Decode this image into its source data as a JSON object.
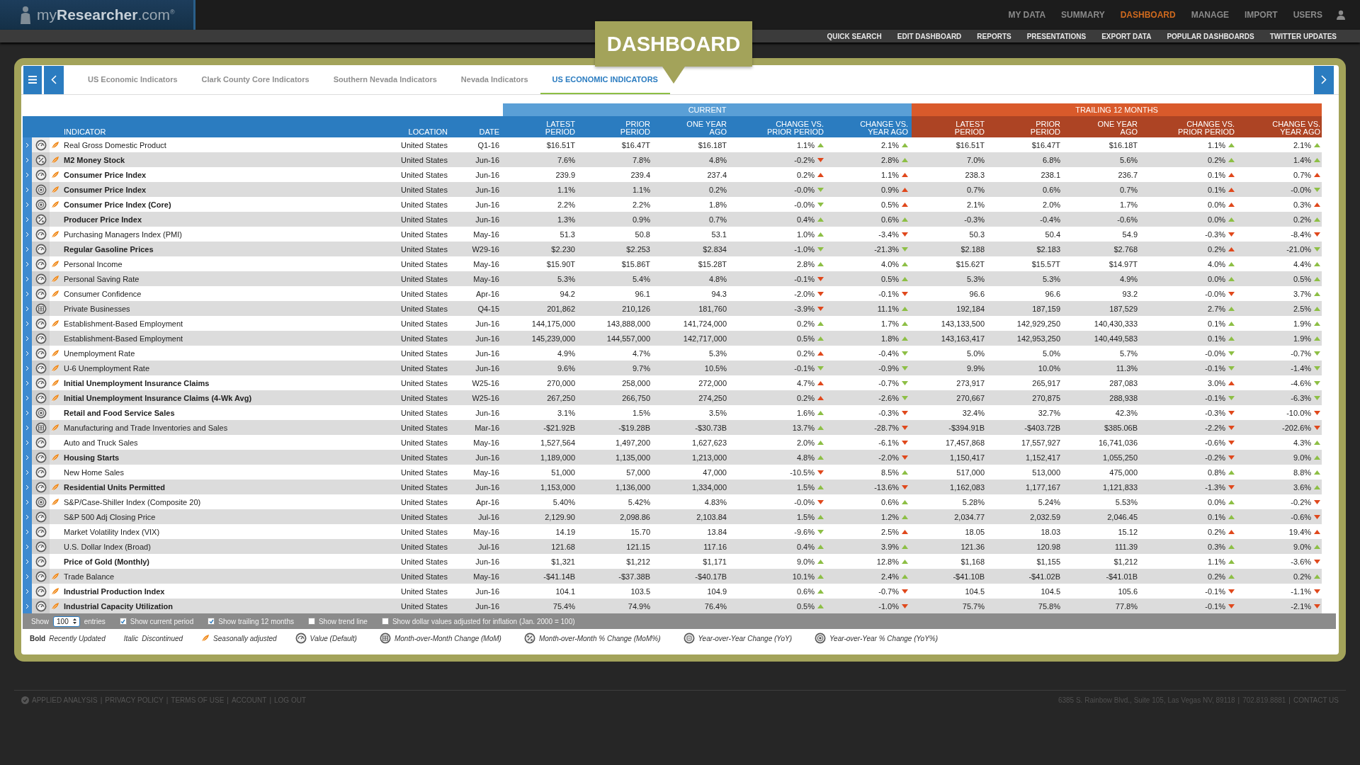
{
  "logo": {
    "text": "my**Researcher**.com$^{®}$"
  },
  "nav": [
    {
      "label": "MY DATA",
      "selected": false
    },
    {
      "label": "SUMMARY",
      "selected": false
    },
    {
      "label": "DASHBOARD",
      "selected": true
    },
    {
      "label": "MANAGE",
      "selected": false
    },
    {
      "label": "IMPORT",
      "selected": false
    },
    {
      "label": "USERS",
      "selected": false
    }
  ],
  "subnav": [
    "QUICK SEARCH",
    "EDIT DASHBOARD",
    "REPORTS",
    "PRESENTATIONS",
    "EXPORT DATA",
    "POPULAR DASHBOARDS",
    "TWITTER UPDATES"
  ],
  "page_title": "DASHBOARD",
  "tabs": [
    {
      "label": "US Economic Indicators",
      "selected": false
    },
    {
      "label": "Clark County Core Indicators",
      "selected": false
    },
    {
      "label": "Southern Nevada Indicators",
      "selected": false
    },
    {
      "label": "Nevada Indicators",
      "selected": false
    },
    {
      "label": "US ECONOMIC INDICATORS",
      "selected": true
    }
  ],
  "table": {
    "groups": [
      "CURRENT",
      "TRAILING 12 MONTHS"
    ],
    "columns": [
      "INDICATOR",
      "LOCATION",
      "DATE"
    ],
    "current_columns": [
      "LATEST PERIOD",
      "PRIOR PERIOD",
      "ONE YEAR AGO",
      "CHANGE VS. PRIOR PERIOD",
      "CHANGE VS. YEAR AGO"
    ],
    "trailing_columns": [
      "LATEST PERIOD",
      "PRIOR PERIOD",
      "ONE YEAR AGO",
      "CHANGE VS. PRIOR PERIOD",
      "CHANGE VS. YEAR AGO"
    ],
    "rows": [
      {
        "indicator": "Real Gross Domestic Product",
        "kind": "value",
        "seasonal": true,
        "bold": false,
        "location": "United States",
        "date": "Q1-16",
        "current": [
          "$16.51T",
          "$16.47T",
          "$16.18T"
        ],
        "current_chg": [
          {
            "v": "1.1%",
            "kind": "up",
            "good": true
          },
          {
            "v": "2.1%",
            "kind": "up",
            "good": true
          }
        ],
        "trailing": [
          "$16.51T",
          "$16.47T",
          "$16.18T"
        ],
        "trailing_chg": [
          {
            "v": "1.1%",
            "kind": "up",
            "good": true
          },
          {
            "v": "2.1%",
            "kind": "up",
            "good": true
          }
        ]
      },
      {
        "indicator": "M2 Money Stock",
        "kind": "mompct",
        "seasonal": true,
        "bold": true,
        "location": "United States",
        "date": "Jun-16",
        "current": [
          "7.6%",
          "7.8%",
          "4.8%"
        ],
        "current_chg": [
          {
            "v": "-0.2%",
            "kind": "down",
            "good": false
          },
          {
            "v": "2.8%",
            "kind": "up",
            "good": true
          }
        ],
        "trailing": [
          "7.0%",
          "6.8%",
          "5.6%"
        ],
        "trailing_chg": [
          {
            "v": "0.2%",
            "kind": "up",
            "good": true
          },
          {
            "v": "1.4%",
            "kind": "up",
            "good": true
          }
        ]
      },
      {
        "indicator": "Consumer Price Index",
        "kind": "value",
        "seasonal": true,
        "bold": true,
        "location": "United States",
        "date": "Jun-16",
        "current": [
          "239.9",
          "239.4",
          "237.4"
        ],
        "current_chg": [
          {
            "v": "0.2%",
            "kind": "up",
            "good": false
          },
          {
            "v": "1.1%",
            "kind": "up",
            "good": false
          }
        ],
        "trailing": [
          "238.3",
          "238.1",
          "236.7"
        ],
        "trailing_chg": [
          {
            "v": "0.1%",
            "kind": "up",
            "good": false
          },
          {
            "v": "0.7%",
            "kind": "up",
            "good": false
          }
        ]
      },
      {
        "indicator": "Consumer Price Index",
        "kind": "yoypct",
        "seasonal": true,
        "bold": true,
        "location": "United States",
        "date": "Jun-16",
        "current": [
          "1.1%",
          "1.1%",
          "0.2%"
        ],
        "current_chg": [
          {
            "v": "-0.0%",
            "kind": "down",
            "good": true
          },
          {
            "v": "0.9%",
            "kind": "up",
            "good": false
          }
        ],
        "trailing": [
          "0.7%",
          "0.6%",
          "0.7%"
        ],
        "trailing_chg": [
          {
            "v": "0.1%",
            "kind": "up",
            "good": false
          },
          {
            "v": "-0.0%",
            "kind": "down",
            "good": true
          }
        ]
      },
      {
        "indicator": "Consumer Price Index (Core)",
        "kind": "yoypct",
        "seasonal": true,
        "bold": true,
        "location": "United States",
        "date": "Jun-16",
        "current": [
          "2.2%",
          "2.2%",
          "1.8%"
        ],
        "current_chg": [
          {
            "v": "-0.0%",
            "kind": "down",
            "good": true
          },
          {
            "v": "0.5%",
            "kind": "up",
            "good": false
          }
        ],
        "trailing": [
          "2.1%",
          "2.0%",
          "1.7%"
        ],
        "trailing_chg": [
          {
            "v": "0.0%",
            "kind": "up",
            "good": false
          },
          {
            "v": "0.3%",
            "kind": "up",
            "good": false
          }
        ]
      },
      {
        "indicator": "Producer Price Index",
        "kind": "mompct",
        "seasonal": false,
        "bold": true,
        "location": "United States",
        "date": "Jun-16",
        "current": [
          "1.3%",
          "0.9%",
          "0.7%"
        ],
        "current_chg": [
          {
            "v": "0.4%",
            "kind": "up",
            "good": true
          },
          {
            "v": "0.6%",
            "kind": "up",
            "good": true
          }
        ],
        "trailing": [
          "-0.3%",
          "-0.4%",
          "-0.6%"
        ],
        "trailing_chg": [
          {
            "v": "0.0%",
            "kind": "up",
            "good": true
          },
          {
            "v": "0.2%",
            "kind": "up",
            "good": true
          }
        ]
      },
      {
        "indicator": "Purchasing Managers Index (PMI)",
        "kind": "value",
        "seasonal": true,
        "bold": false,
        "location": "United States",
        "date": "May-16",
        "current": [
          "51.3",
          "50.8",
          "53.1"
        ],
        "current_chg": [
          {
            "v": "1.0%",
            "kind": "up",
            "good": true
          },
          {
            "v": "-3.4%",
            "kind": "down",
            "good": false
          }
        ],
        "trailing": [
          "50.3",
          "50.4",
          "54.9"
        ],
        "trailing_chg": [
          {
            "v": "-0.3%",
            "kind": "down",
            "good": false
          },
          {
            "v": "-8.4%",
            "kind": "down",
            "good": false
          }
        ]
      },
      {
        "indicator": "Regular Gasoline Prices",
        "kind": "value",
        "seasonal": false,
        "bold": true,
        "location": "United States",
        "date": "W29-16",
        "current": [
          "$2.230",
          "$2.253",
          "$2.834"
        ],
        "current_chg": [
          {
            "v": "-1.0%",
            "kind": "down",
            "good": true
          },
          {
            "v": "-21.3%",
            "kind": "down",
            "good": true
          }
        ],
        "trailing": [
          "$2.188",
          "$2.183",
          "$2.768"
        ],
        "trailing_chg": [
          {
            "v": "0.2%",
            "kind": "up",
            "good": false
          },
          {
            "v": "-21.0%",
            "kind": "down",
            "good": true
          }
        ]
      },
      {
        "indicator": "Personal Income",
        "kind": "value",
        "seasonal": true,
        "bold": false,
        "location": "United States",
        "date": "May-16",
        "current": [
          "$15.90T",
          "$15.86T",
          "$15.28T"
        ],
        "current_chg": [
          {
            "v": "2.8%",
            "kind": "up",
            "good": true
          },
          {
            "v": "4.0%",
            "kind": "up",
            "good": true
          }
        ],
        "trailing": [
          "$15.62T",
          "$15.57T",
          "$14.97T"
        ],
        "trailing_chg": [
          {
            "v": "4.0%",
            "kind": "up",
            "good": true
          },
          {
            "v": "4.4%",
            "kind": "up",
            "good": true
          }
        ]
      },
      {
        "indicator": "Personal Saving Rate",
        "kind": "value",
        "seasonal": true,
        "bold": false,
        "location": "United States",
        "date": "May-16",
        "current": [
          "5.3%",
          "5.4%",
          "4.8%"
        ],
        "current_chg": [
          {
            "v": "-0.1%",
            "kind": "down",
            "good": false
          },
          {
            "v": "0.5%",
            "kind": "up",
            "good": true
          }
        ],
        "trailing": [
          "5.3%",
          "5.3%",
          "4.9%"
        ],
        "trailing_chg": [
          {
            "v": "0.0%",
            "kind": "up",
            "good": true
          },
          {
            "v": "0.5%",
            "kind": "up",
            "good": true
          }
        ]
      },
      {
        "indicator": "Consumer Confidence",
        "kind": "value",
        "seasonal": true,
        "bold": false,
        "location": "United States",
        "date": "Apr-16",
        "current": [
          "94.2",
          "96.1",
          "94.3"
        ],
        "current_chg": [
          {
            "v": "-2.0%",
            "kind": "down",
            "good": false
          },
          {
            "v": "-0.1%",
            "kind": "down",
            "good": false
          }
        ],
        "trailing": [
          "96.6",
          "96.6",
          "93.2"
        ],
        "trailing_chg": [
          {
            "v": "-0.0%",
            "kind": "down",
            "good": false
          },
          {
            "v": "3.7%",
            "kind": "up",
            "good": true
          }
        ]
      },
      {
        "indicator": "Private Businesses",
        "kind": "mom",
        "seasonal": false,
        "bold": false,
        "location": "United States",
        "date": "Q4-15",
        "current": [
          "201,862",
          "210,126",
          "181,760"
        ],
        "current_chg": [
          {
            "v": "-3.9%",
            "kind": "down",
            "good": false
          },
          {
            "v": "11.1%",
            "kind": "up",
            "good": true
          }
        ],
        "trailing": [
          "192,184",
          "187,159",
          "187,529"
        ],
        "trailing_chg": [
          {
            "v": "2.7%",
            "kind": "up",
            "good": true
          },
          {
            "v": "2.5%",
            "kind": "up",
            "good": true
          }
        ]
      },
      {
        "indicator": "Establishment-Based Employment",
        "kind": "value",
        "seasonal": true,
        "bold": false,
        "location": "United States",
        "date": "Jun-16",
        "current": [
          "144,175,000",
          "143,888,000",
          "141,724,000"
        ],
        "current_chg": [
          {
            "v": "0.2%",
            "kind": "up",
            "good": true
          },
          {
            "v": "1.7%",
            "kind": "up",
            "good": true
          }
        ],
        "trailing": [
          "143,133,500",
          "142,929,250",
          "140,430,333"
        ],
        "trailing_chg": [
          {
            "v": "0.1%",
            "kind": "up",
            "good": true
          },
          {
            "v": "1.9%",
            "kind": "up",
            "good": true
          }
        ]
      },
      {
        "indicator": "Establishment-Based Employment",
        "kind": "value",
        "seasonal": false,
        "bold": false,
        "location": "United States",
        "date": "Jun-16",
        "current": [
          "145,239,000",
          "144,557,000",
          "142,717,000"
        ],
        "current_chg": [
          {
            "v": "0.5%",
            "kind": "up",
            "good": true
          },
          {
            "v": "1.8%",
            "kind": "up",
            "good": true
          }
        ],
        "trailing": [
          "143,163,417",
          "142,953,250",
          "140,449,583"
        ],
        "trailing_chg": [
          {
            "v": "0.1%",
            "kind": "up",
            "good": true
          },
          {
            "v": "1.9%",
            "kind": "up",
            "good": true
          }
        ]
      },
      {
        "indicator": "Unemployment Rate",
        "kind": "value",
        "seasonal": true,
        "bold": false,
        "location": "United States",
        "date": "Jun-16",
        "current": [
          "4.9%",
          "4.7%",
          "5.3%"
        ],
        "current_chg": [
          {
            "v": "0.2%",
            "kind": "up",
            "good": false
          },
          {
            "v": "-0.4%",
            "kind": "down",
            "good": true
          }
        ],
        "trailing": [
          "5.0%",
          "5.0%",
          "5.7%"
        ],
        "trailing_chg": [
          {
            "v": "-0.0%",
            "kind": "down",
            "good": true
          },
          {
            "v": "-0.7%",
            "kind": "down",
            "good": true
          }
        ]
      },
      {
        "indicator": "U-6 Unemployment Rate",
        "kind": "value",
        "seasonal": true,
        "bold": false,
        "location": "United States",
        "date": "Jun-16",
        "current": [
          "9.6%",
          "9.7%",
          "10.5%"
        ],
        "current_chg": [
          {
            "v": "-0.1%",
            "kind": "down",
            "good": true
          },
          {
            "v": "-0.9%",
            "kind": "down",
            "good": true
          }
        ],
        "trailing": [
          "9.9%",
          "10.0%",
          "11.3%"
        ],
        "trailing_chg": [
          {
            "v": "-0.1%",
            "kind": "down",
            "good": true
          },
          {
            "v": "-1.4%",
            "kind": "down",
            "good": true
          }
        ]
      },
      {
        "indicator": "Initial Unemployment Insurance Claims",
        "kind": "value",
        "seasonal": true,
        "bold": true,
        "location": "United States",
        "date": "W25-16",
        "current": [
          "270,000",
          "258,000",
          "272,000"
        ],
        "current_chg": [
          {
            "v": "4.7%",
            "kind": "up",
            "good": false
          },
          {
            "v": "-0.7%",
            "kind": "down",
            "good": true
          }
        ],
        "trailing": [
          "273,917",
          "265,917",
          "287,083"
        ],
        "trailing_chg": [
          {
            "v": "3.0%",
            "kind": "up",
            "good": false
          },
          {
            "v": "-4.6%",
            "kind": "down",
            "good": true
          }
        ]
      },
      {
        "indicator": "Initial Unemployment Insurance Claims (4-Wk Avg)",
        "kind": "value",
        "seasonal": true,
        "bold": true,
        "location": "United States",
        "date": "W25-16",
        "current": [
          "267,250",
          "266,750",
          "274,250"
        ],
        "current_chg": [
          {
            "v": "0.2%",
            "kind": "up",
            "good": false
          },
          {
            "v": "-2.6%",
            "kind": "down",
            "good": true
          }
        ],
        "trailing": [
          "270,667",
          "270,875",
          "288,938"
        ],
        "trailing_chg": [
          {
            "v": "-0.1%",
            "kind": "down",
            "good": true
          },
          {
            "v": "-6.3%",
            "kind": "down",
            "good": true
          }
        ]
      },
      {
        "indicator": "Retail and Food Service Sales",
        "kind": "yoypct",
        "seasonal": false,
        "bold": true,
        "location": "United States",
        "date": "Jun-16",
        "current": [
          "3.1%",
          "1.5%",
          "3.5%"
        ],
        "current_chg": [
          {
            "v": "1.6%",
            "kind": "up",
            "good": true
          },
          {
            "v": "-0.3%",
            "kind": "down",
            "good": false
          }
        ],
        "trailing": [
          "32.4%",
          "32.7%",
          "42.3%"
        ],
        "trailing_chg": [
          {
            "v": "-0.3%",
            "kind": "down",
            "good": false
          },
          {
            "v": "-10.0%",
            "kind": "down",
            "good": false
          }
        ]
      },
      {
        "indicator": "Manufacturing and Trade Inventories and Sales",
        "kind": "mom",
        "seasonal": true,
        "bold": false,
        "location": "United States",
        "date": "Mar-16",
        "current": [
          "-$21.92B",
          "-$19.28B",
          "-$30.73B"
        ],
        "current_chg": [
          {
            "v": "13.7%",
            "kind": "up",
            "good": true
          },
          {
            "v": "-28.7%",
            "kind": "down",
            "good": false
          }
        ],
        "trailing": [
          "-$394.91B",
          "-$403.72B",
          "$385.06B"
        ],
        "trailing_chg": [
          {
            "v": "-2.2%",
            "kind": "down",
            "good": false
          },
          {
            "v": "-202.6%",
            "kind": "down",
            "good": false
          }
        ]
      },
      {
        "indicator": "Auto and Truck Sales",
        "kind": "value",
        "seasonal": false,
        "bold": false,
        "location": "United States",
        "date": "May-16",
        "current": [
          "1,527,564",
          "1,497,200",
          "1,627,623"
        ],
        "current_chg": [
          {
            "v": "2.0%",
            "kind": "up",
            "good": true
          },
          {
            "v": "-6.1%",
            "kind": "down",
            "good": false
          }
        ],
        "trailing": [
          "17,457,868",
          "17,557,927",
          "16,741,036"
        ],
        "trailing_chg": [
          {
            "v": "-0.6%",
            "kind": "down",
            "good": false
          },
          {
            "v": "4.3%",
            "kind": "up",
            "good": true
          }
        ]
      },
      {
        "indicator": "Housing Starts",
        "kind": "value",
        "seasonal": true,
        "bold": true,
        "location": "United States",
        "date": "Jun-16",
        "current": [
          "1,189,000",
          "1,135,000",
          "1,213,000"
        ],
        "current_chg": [
          {
            "v": "4.8%",
            "kind": "up",
            "good": true
          },
          {
            "v": "-2.0%",
            "kind": "down",
            "good": false
          }
        ],
        "trailing": [
          "1,150,417",
          "1,152,417",
          "1,055,250"
        ],
        "trailing_chg": [
          {
            "v": "-0.2%",
            "kind": "down",
            "good": false
          },
          {
            "v": "9.0%",
            "kind": "up",
            "good": true
          }
        ]
      },
      {
        "indicator": "New Home Sales",
        "kind": "value",
        "seasonal": false,
        "bold": false,
        "location": "United States",
        "date": "May-16",
        "current": [
          "51,000",
          "57,000",
          "47,000"
        ],
        "current_chg": [
          {
            "v": "-10.5%",
            "kind": "down",
            "good": false
          },
          {
            "v": "8.5%",
            "kind": "up",
            "good": true
          }
        ],
        "trailing": [
          "517,000",
          "513,000",
          "475,000"
        ],
        "trailing_chg": [
          {
            "v": "0.8%",
            "kind": "up",
            "good": true
          },
          {
            "v": "8.8%",
            "kind": "up",
            "good": true
          }
        ]
      },
      {
        "indicator": "Residential Units Permitted",
        "kind": "value",
        "seasonal": true,
        "bold": true,
        "location": "United States",
        "date": "Jun-16",
        "current": [
          "1,153,000",
          "1,136,000",
          "1,334,000"
        ],
        "current_chg": [
          {
            "v": "1.5%",
            "kind": "up",
            "good": true
          },
          {
            "v": "-13.6%",
            "kind": "down",
            "good": false
          }
        ],
        "trailing": [
          "1,162,083",
          "1,177,167",
          "1,121,833"
        ],
        "trailing_chg": [
          {
            "v": "-1.3%",
            "kind": "down",
            "good": false
          },
          {
            "v": "3.6%",
            "kind": "up",
            "good": true
          }
        ]
      },
      {
        "indicator": "S&P/Case-Shiller Index (Composite 20)",
        "kind": "yoypct",
        "seasonal": true,
        "bold": false,
        "location": "United States",
        "date": "Apr-16",
        "current": [
          "5.40%",
          "5.42%",
          "4.83%"
        ],
        "current_chg": [
          {
            "v": "-0.0%",
            "kind": "down",
            "good": false
          },
          {
            "v": "0.6%",
            "kind": "up",
            "good": true
          }
        ],
        "trailing": [
          "5.28%",
          "5.24%",
          "5.53%"
        ],
        "trailing_chg": [
          {
            "v": "0.0%",
            "kind": "up",
            "good": true
          },
          {
            "v": "-0.2%",
            "kind": "down",
            "good": false
          }
        ]
      },
      {
        "indicator": "S&P 500 Adj Closing Price",
        "kind": "value",
        "seasonal": false,
        "bold": false,
        "location": "United States",
        "date": "Jul-16",
        "current": [
          "2,129.90",
          "2,098.86",
          "2,103.84"
        ],
        "current_chg": [
          {
            "v": "1.5%",
            "kind": "up",
            "good": true
          },
          {
            "v": "1.2%",
            "kind": "up",
            "good": true
          }
        ],
        "trailing": [
          "2,034.77",
          "2,032.59",
          "2,046.45"
        ],
        "trailing_chg": [
          {
            "v": "0.1%",
            "kind": "up",
            "good": true
          },
          {
            "v": "-0.6%",
            "kind": "down",
            "good": false
          }
        ]
      },
      {
        "indicator": "Market Volatility Index (VIX)",
        "kind": "value",
        "seasonal": false,
        "bold": false,
        "location": "United States",
        "date": "May-16",
        "current": [
          "14.19",
          "15.70",
          "13.84"
        ],
        "current_chg": [
          {
            "v": "-9.6%",
            "kind": "down",
            "good": true
          },
          {
            "v": "2.5%",
            "kind": "up",
            "good": false
          }
        ],
        "trailing": [
          "18.05",
          "18.03",
          "15.12"
        ],
        "trailing_chg": [
          {
            "v": "0.2%",
            "kind": "up",
            "good": false
          },
          {
            "v": "19.4%",
            "kind": "up",
            "good": false
          }
        ]
      },
      {
        "indicator": "U.S. Dollar Index (Broad)",
        "kind": "value",
        "seasonal": false,
        "bold": false,
        "location": "United States",
        "date": "Jul-16",
        "current": [
          "121.68",
          "121.15",
          "117.16"
        ],
        "current_chg": [
          {
            "v": "0.4%",
            "kind": "up",
            "good": true
          },
          {
            "v": "3.9%",
            "kind": "up",
            "good": true
          }
        ],
        "trailing": [
          "121.36",
          "120.98",
          "111.39"
        ],
        "trailing_chg": [
          {
            "v": "0.3%",
            "kind": "up",
            "good": true
          },
          {
            "v": "9.0%",
            "kind": "up",
            "good": true
          }
        ]
      },
      {
        "indicator": "Price of Gold (Monthly)",
        "kind": "value",
        "seasonal": false,
        "bold": true,
        "location": "United States",
        "date": "Jun-16",
        "current": [
          "$1,321",
          "$1,212",
          "$1,171"
        ],
        "current_chg": [
          {
            "v": "9.0%",
            "kind": "up",
            "good": true
          },
          {
            "v": "12.8%",
            "kind": "up",
            "good": true
          }
        ],
        "trailing": [
          "$1,168",
          "$1,155",
          "$1,212"
        ],
        "trailing_chg": [
          {
            "v": "1.1%",
            "kind": "up",
            "good": true
          },
          {
            "v": "-3.6%",
            "kind": "down",
            "good": false
          }
        ]
      },
      {
        "indicator": "Trade Balance",
        "kind": "value",
        "seasonal": true,
        "bold": false,
        "location": "United States",
        "date": "May-16",
        "current": [
          "-$41.14B",
          "-$37.38B",
          "-$40.17B"
        ],
        "current_chg": [
          {
            "v": "10.1%",
            "kind": "up",
            "good": true
          },
          {
            "v": "2.4%",
            "kind": "up",
            "good": true
          }
        ],
        "trailing": [
          "-$41.10B",
          "-$41.02B",
          "-$41.01B"
        ],
        "trailing_chg": [
          {
            "v": "0.2%",
            "kind": "up",
            "good": true
          },
          {
            "v": "0.2%",
            "kind": "up",
            "good": true
          }
        ]
      },
      {
        "indicator": "Industrial Production Index",
        "kind": "value",
        "seasonal": true,
        "bold": true,
        "location": "United States",
        "date": "Jun-16",
        "current": [
          "104.1",
          "103.5",
          "104.9"
        ],
        "current_chg": [
          {
            "v": "0.6%",
            "kind": "up",
            "good": true
          },
          {
            "v": "-0.7%",
            "kind": "down",
            "good": false
          }
        ],
        "trailing": [
          "104.5",
          "104.5",
          "105.6"
        ],
        "trailing_chg": [
          {
            "v": "-0.1%",
            "kind": "down",
            "good": false
          },
          {
            "v": "-1.1%",
            "kind": "down",
            "good": false
          }
        ]
      },
      {
        "indicator": "Industrial Capacity Utilization",
        "kind": "value",
        "seasonal": true,
        "bold": true,
        "location": "United States",
        "date": "Jun-16",
        "current": [
          "75.4%",
          "74.9%",
          "76.4%"
        ],
        "current_chg": [
          {
            "v": "0.5%",
            "kind": "up",
            "good": true
          },
          {
            "v": "-1.0%",
            "kind": "down",
            "good": false
          }
        ],
        "trailing": [
          "75.7%",
          "75.8%",
          "77.8%"
        ],
        "trailing_chg": [
          {
            "v": "-0.1%",
            "kind": "down",
            "good": false
          },
          {
            "v": "-2.1%",
            "kind": "down",
            "good": false
          }
        ]
      }
    ]
  },
  "controls": {
    "show_label": "Show",
    "entries_value": "100",
    "entries_label": "entries",
    "options": [
      {
        "label": "Show current period",
        "checked": true
      },
      {
        "label": "Show trailing 12 months",
        "checked": true
      },
      {
        "label": "Show trend line",
        "checked": false
      },
      {
        "label": "Show dollar values adjusted for inflation (Jan. 2000 = 100)",
        "checked": false
      }
    ]
  },
  "legend": {
    "styles": [
      {
        "kind": "bold",
        "sample": "Bold",
        "label": "Recently Updated"
      },
      {
        "kind": "italic",
        "sample": "Italic",
        "label": "Discontinued"
      }
    ],
    "seasonal_label": "Seasonally adjusted",
    "icons": [
      {
        "kind": "value",
        "label": "Value (Default)"
      },
      {
        "kind": "mom",
        "label": "Month-over-Month Change (MoM)"
      },
      {
        "kind": "mompct",
        "label": "Month-over-Month % Change (MoM%)"
      },
      {
        "kind": "yoy",
        "label": "Year-over-Year Change (YoY)"
      },
      {
        "kind": "yoypct",
        "label": "Year-over-Year % Change (YoY%)"
      }
    ]
  },
  "footer": {
    "links": [
      "APPLIED ANALYSIS",
      "PRIVACY POLICY",
      "TERMS OF USE",
      "ACCOUNT",
      "LOG OUT"
    ],
    "separator": "|",
    "address": [
      "6385 S. Rainbow Blvd., Suite 105, Las Vegas NV, 89118",
      "702.819.8881",
      "CONTACT US"
    ]
  }
}
